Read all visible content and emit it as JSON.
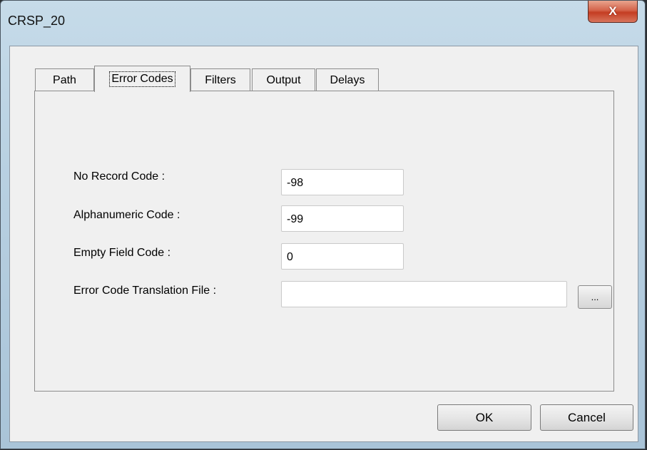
{
  "window": {
    "title": "CRSP_20",
    "close_glyph": "X"
  },
  "tabs": [
    {
      "label": "Path"
    },
    {
      "label": "Error Codes"
    },
    {
      "label": "Filters"
    },
    {
      "label": "Output"
    },
    {
      "label": "Delays"
    }
  ],
  "active_tab": "Error Codes",
  "fields": {
    "no_record": {
      "label": "No Record Code :",
      "value": "-98"
    },
    "alphanumeric": {
      "label": "Alphanumeric Code :",
      "value": "-99"
    },
    "empty_field": {
      "label": "Empty Field Code :",
      "value": "0"
    },
    "translation_file": {
      "label": "Error Code Translation File :",
      "value": ""
    }
  },
  "browse_label": "...",
  "buttons": {
    "ok": "OK",
    "cancel": "Cancel"
  },
  "colors": {
    "close_button": "#c43d22",
    "frame": "#b9d1e2",
    "client": "#f0f0f0"
  },
  "icons": {
    "close": "close-icon"
  }
}
